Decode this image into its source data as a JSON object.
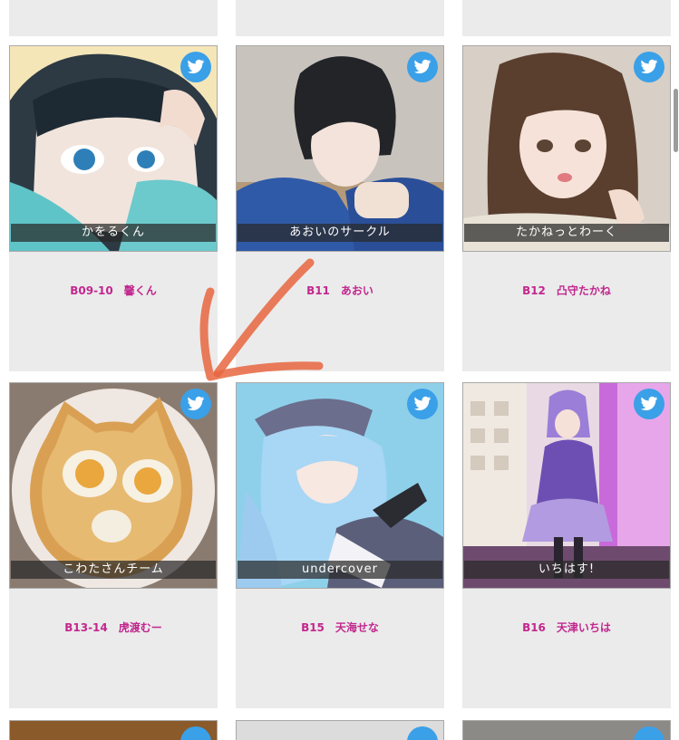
{
  "cards": [
    {
      "name": "かをるくん",
      "caption": "B09-10　馨くん"
    },
    {
      "name": "あおいのサークル",
      "caption": "B11　あおい"
    },
    {
      "name": "たかねっとわーく",
      "caption": "B12　凸守たかね"
    },
    {
      "name": "こわたさんチーム",
      "caption": "B13-14　虎渡むー"
    },
    {
      "name": "undercover",
      "caption": "B15　天海せな"
    },
    {
      "name": "いちはす!",
      "caption": "B16　天津いちは"
    }
  ],
  "icons": {
    "social": "twitter-bird-icon",
    "annotation": "orange-arrow"
  },
  "colors": {
    "caption": "#c2278e",
    "twitter": "#3aa0e8",
    "card_bg": "#ebebeb",
    "arrow": "#e8663f"
  }
}
